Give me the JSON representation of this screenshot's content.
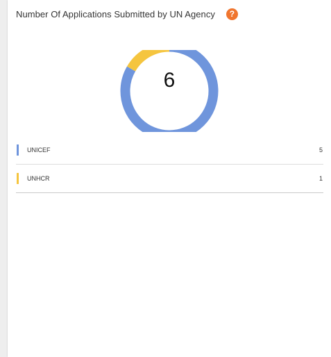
{
  "card": {
    "title": "Number Of Applications Submitted by UN Agency",
    "info_badge": "?",
    "badge_color": "#f0752e"
  },
  "chart_data": {
    "type": "pie",
    "variant": "donut",
    "title": "Number Of Applications Submitted by UN Agency",
    "total": "6",
    "categories": [
      "UNICEF",
      "UNHCR"
    ],
    "values": [
      5,
      1
    ],
    "colors": [
      "#6f95dc",
      "#f5c53f"
    ],
    "legend": "below"
  },
  "legend": [
    {
      "label": "UNICEF",
      "value": "5"
    },
    {
      "label": "UNHCR",
      "value": "1"
    }
  ]
}
